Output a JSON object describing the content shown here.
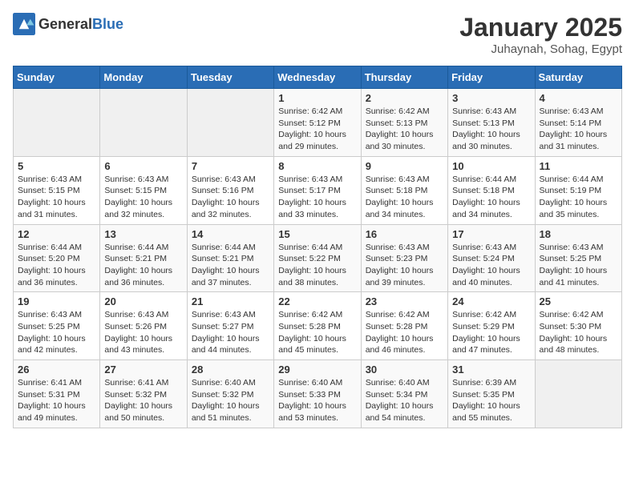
{
  "header": {
    "logo_general": "General",
    "logo_blue": "Blue",
    "month": "January 2025",
    "location": "Juhaynah, Sohag, Egypt"
  },
  "weekdays": [
    "Sunday",
    "Monday",
    "Tuesday",
    "Wednesday",
    "Thursday",
    "Friday",
    "Saturday"
  ],
  "weeks": [
    [
      {
        "day": "",
        "info": ""
      },
      {
        "day": "",
        "info": ""
      },
      {
        "day": "",
        "info": ""
      },
      {
        "day": "1",
        "info": "Sunrise: 6:42 AM\nSunset: 5:12 PM\nDaylight: 10 hours\nand 29 minutes."
      },
      {
        "day": "2",
        "info": "Sunrise: 6:42 AM\nSunset: 5:13 PM\nDaylight: 10 hours\nand 30 minutes."
      },
      {
        "day": "3",
        "info": "Sunrise: 6:43 AM\nSunset: 5:13 PM\nDaylight: 10 hours\nand 30 minutes."
      },
      {
        "day": "4",
        "info": "Sunrise: 6:43 AM\nSunset: 5:14 PM\nDaylight: 10 hours\nand 31 minutes."
      }
    ],
    [
      {
        "day": "5",
        "info": "Sunrise: 6:43 AM\nSunset: 5:15 PM\nDaylight: 10 hours\nand 31 minutes."
      },
      {
        "day": "6",
        "info": "Sunrise: 6:43 AM\nSunset: 5:15 PM\nDaylight: 10 hours\nand 32 minutes."
      },
      {
        "day": "7",
        "info": "Sunrise: 6:43 AM\nSunset: 5:16 PM\nDaylight: 10 hours\nand 32 minutes."
      },
      {
        "day": "8",
        "info": "Sunrise: 6:43 AM\nSunset: 5:17 PM\nDaylight: 10 hours\nand 33 minutes."
      },
      {
        "day": "9",
        "info": "Sunrise: 6:43 AM\nSunset: 5:18 PM\nDaylight: 10 hours\nand 34 minutes."
      },
      {
        "day": "10",
        "info": "Sunrise: 6:44 AM\nSunset: 5:18 PM\nDaylight: 10 hours\nand 34 minutes."
      },
      {
        "day": "11",
        "info": "Sunrise: 6:44 AM\nSunset: 5:19 PM\nDaylight: 10 hours\nand 35 minutes."
      }
    ],
    [
      {
        "day": "12",
        "info": "Sunrise: 6:44 AM\nSunset: 5:20 PM\nDaylight: 10 hours\nand 36 minutes."
      },
      {
        "day": "13",
        "info": "Sunrise: 6:44 AM\nSunset: 5:21 PM\nDaylight: 10 hours\nand 36 minutes."
      },
      {
        "day": "14",
        "info": "Sunrise: 6:44 AM\nSunset: 5:21 PM\nDaylight: 10 hours\nand 37 minutes."
      },
      {
        "day": "15",
        "info": "Sunrise: 6:44 AM\nSunset: 5:22 PM\nDaylight: 10 hours\nand 38 minutes."
      },
      {
        "day": "16",
        "info": "Sunrise: 6:43 AM\nSunset: 5:23 PM\nDaylight: 10 hours\nand 39 minutes."
      },
      {
        "day": "17",
        "info": "Sunrise: 6:43 AM\nSunset: 5:24 PM\nDaylight: 10 hours\nand 40 minutes."
      },
      {
        "day": "18",
        "info": "Sunrise: 6:43 AM\nSunset: 5:25 PM\nDaylight: 10 hours\nand 41 minutes."
      }
    ],
    [
      {
        "day": "19",
        "info": "Sunrise: 6:43 AM\nSunset: 5:25 PM\nDaylight: 10 hours\nand 42 minutes."
      },
      {
        "day": "20",
        "info": "Sunrise: 6:43 AM\nSunset: 5:26 PM\nDaylight: 10 hours\nand 43 minutes."
      },
      {
        "day": "21",
        "info": "Sunrise: 6:43 AM\nSunset: 5:27 PM\nDaylight: 10 hours\nand 44 minutes."
      },
      {
        "day": "22",
        "info": "Sunrise: 6:42 AM\nSunset: 5:28 PM\nDaylight: 10 hours\nand 45 minutes."
      },
      {
        "day": "23",
        "info": "Sunrise: 6:42 AM\nSunset: 5:28 PM\nDaylight: 10 hours\nand 46 minutes."
      },
      {
        "day": "24",
        "info": "Sunrise: 6:42 AM\nSunset: 5:29 PM\nDaylight: 10 hours\nand 47 minutes."
      },
      {
        "day": "25",
        "info": "Sunrise: 6:42 AM\nSunset: 5:30 PM\nDaylight: 10 hours\nand 48 minutes."
      }
    ],
    [
      {
        "day": "26",
        "info": "Sunrise: 6:41 AM\nSunset: 5:31 PM\nDaylight: 10 hours\nand 49 minutes."
      },
      {
        "day": "27",
        "info": "Sunrise: 6:41 AM\nSunset: 5:32 PM\nDaylight: 10 hours\nand 50 minutes."
      },
      {
        "day": "28",
        "info": "Sunrise: 6:40 AM\nSunset: 5:32 PM\nDaylight: 10 hours\nand 51 minutes."
      },
      {
        "day": "29",
        "info": "Sunrise: 6:40 AM\nSunset: 5:33 PM\nDaylight: 10 hours\nand 53 minutes."
      },
      {
        "day": "30",
        "info": "Sunrise: 6:40 AM\nSunset: 5:34 PM\nDaylight: 10 hours\nand 54 minutes."
      },
      {
        "day": "31",
        "info": "Sunrise: 6:39 AM\nSunset: 5:35 PM\nDaylight: 10 hours\nand 55 minutes."
      },
      {
        "day": "",
        "info": ""
      }
    ]
  ]
}
